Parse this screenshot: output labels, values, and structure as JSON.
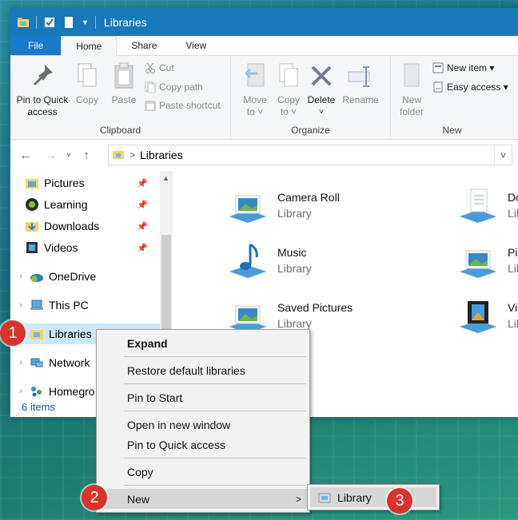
{
  "window": {
    "title": "Libraries"
  },
  "tabs": [
    "File",
    "Home",
    "Share",
    "View"
  ],
  "ribbon": {
    "clipboard": {
      "label": "Clipboard",
      "pin_line1": "Pin to Quick",
      "pin_line2": "access",
      "copy": "Copy",
      "paste": "Paste",
      "cut": "Cut",
      "copy_path": "Copy path",
      "paste_shortcut": "Paste shortcut"
    },
    "organize": {
      "label": "Organize",
      "move_line1": "Move",
      "move_line2": "to ˅",
      "copy_line1": "Copy",
      "copy_line2": "to ˅",
      "delete": "Delete",
      "delete_arrow": "˅",
      "rename": "Rename"
    },
    "new": {
      "label": "New",
      "folder_line1": "New",
      "folder_line2": "folder",
      "new_item": "New item ▾",
      "easy_access": "Easy access ▾"
    }
  },
  "address": {
    "path_sep": ">",
    "location": "Libraries"
  },
  "nav": {
    "pictures": "Pictures",
    "learning": "Learning",
    "downloads": "Downloads",
    "videos": "Videos",
    "onedrive": "OneDrive",
    "thispc": "This PC",
    "libraries": "Libraries",
    "network": "Network",
    "homegroup": "Homegro"
  },
  "status": {
    "items": "6 items"
  },
  "libraries": {
    "subtitle": "Library",
    "camera_roll": "Camera Roll",
    "music": "Music",
    "saved_pictures": "Saved Pictures",
    "documents": "Do",
    "pictures": "Pic",
    "videos": "Vid",
    "sub_cut": "Lib"
  },
  "context_menu": {
    "expand": "Expand",
    "restore": "Restore default libraries",
    "pin_start": "Pin to Start",
    "open_new_window": "Open in new window",
    "pin_quick": "Pin to Quick access",
    "copy": "Copy",
    "new": "New"
  },
  "submenu": {
    "library": "Library"
  },
  "badges": [
    "1",
    "2",
    "3"
  ]
}
